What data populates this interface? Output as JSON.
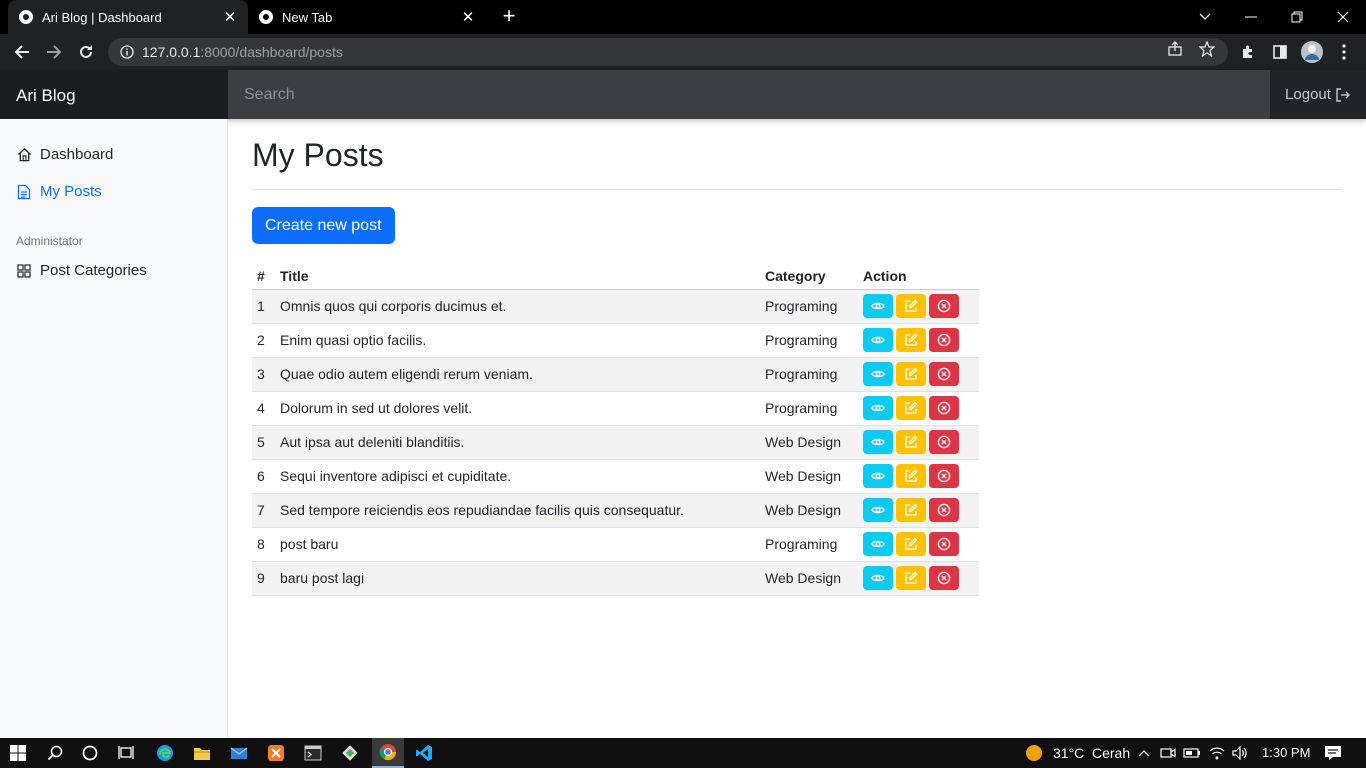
{
  "browser": {
    "tabs": [
      {
        "title": "Ari Blog | Dashboard",
        "active": true
      },
      {
        "title": "New Tab",
        "active": false
      }
    ],
    "url_host": "127.0.0.1",
    "url_path": ":8000/dashboard/posts"
  },
  "nav": {
    "brand": "Ari Blog",
    "search_placeholder": "Search",
    "logout_label": "Logout"
  },
  "sidebar": {
    "items": [
      {
        "label": "Dashboard",
        "icon": "home-icon"
      },
      {
        "label": "My Posts",
        "icon": "file-text-icon"
      }
    ],
    "admin_heading": "Administator",
    "admin_items": [
      {
        "label": "Post Categories",
        "icon": "grid-icon"
      }
    ]
  },
  "main": {
    "title": "My Posts",
    "create_label": "Create new post",
    "columns": [
      "#",
      "Title",
      "Category",
      "Action"
    ],
    "rows": [
      {
        "no": "1",
        "title": "Omnis quos qui corporis ducimus et.",
        "category": "Programing"
      },
      {
        "no": "2",
        "title": "Enim quasi optio facilis.",
        "category": "Programing"
      },
      {
        "no": "3",
        "title": "Quae odio autem eligendi rerum veniam.",
        "category": "Programing"
      },
      {
        "no": "4",
        "title": "Dolorum in sed ut dolores velit.",
        "category": "Programing"
      },
      {
        "no": "5",
        "title": "Aut ipsa aut deleniti blanditiis.",
        "category": "Web Design"
      },
      {
        "no": "6",
        "title": "Sequi inventore adipisci et cupiditate.",
        "category": "Web Design"
      },
      {
        "no": "7",
        "title": "Sed tempore reiciendis eos repudiandae facilis quis consequatur.",
        "category": "Web Design"
      },
      {
        "no": "8",
        "title": "post baru",
        "category": "Programing"
      },
      {
        "no": "9",
        "title": "baru post lagi",
        "category": "Web Design"
      }
    ]
  },
  "taskbar": {
    "weather": "31°C",
    "weather_text": "Cerah",
    "time": "1:30 PM"
  },
  "colors": {
    "primary": "#0d6efd",
    "info": "#0dcaf0",
    "warning": "#ffc107",
    "danger": "#dc3545"
  }
}
